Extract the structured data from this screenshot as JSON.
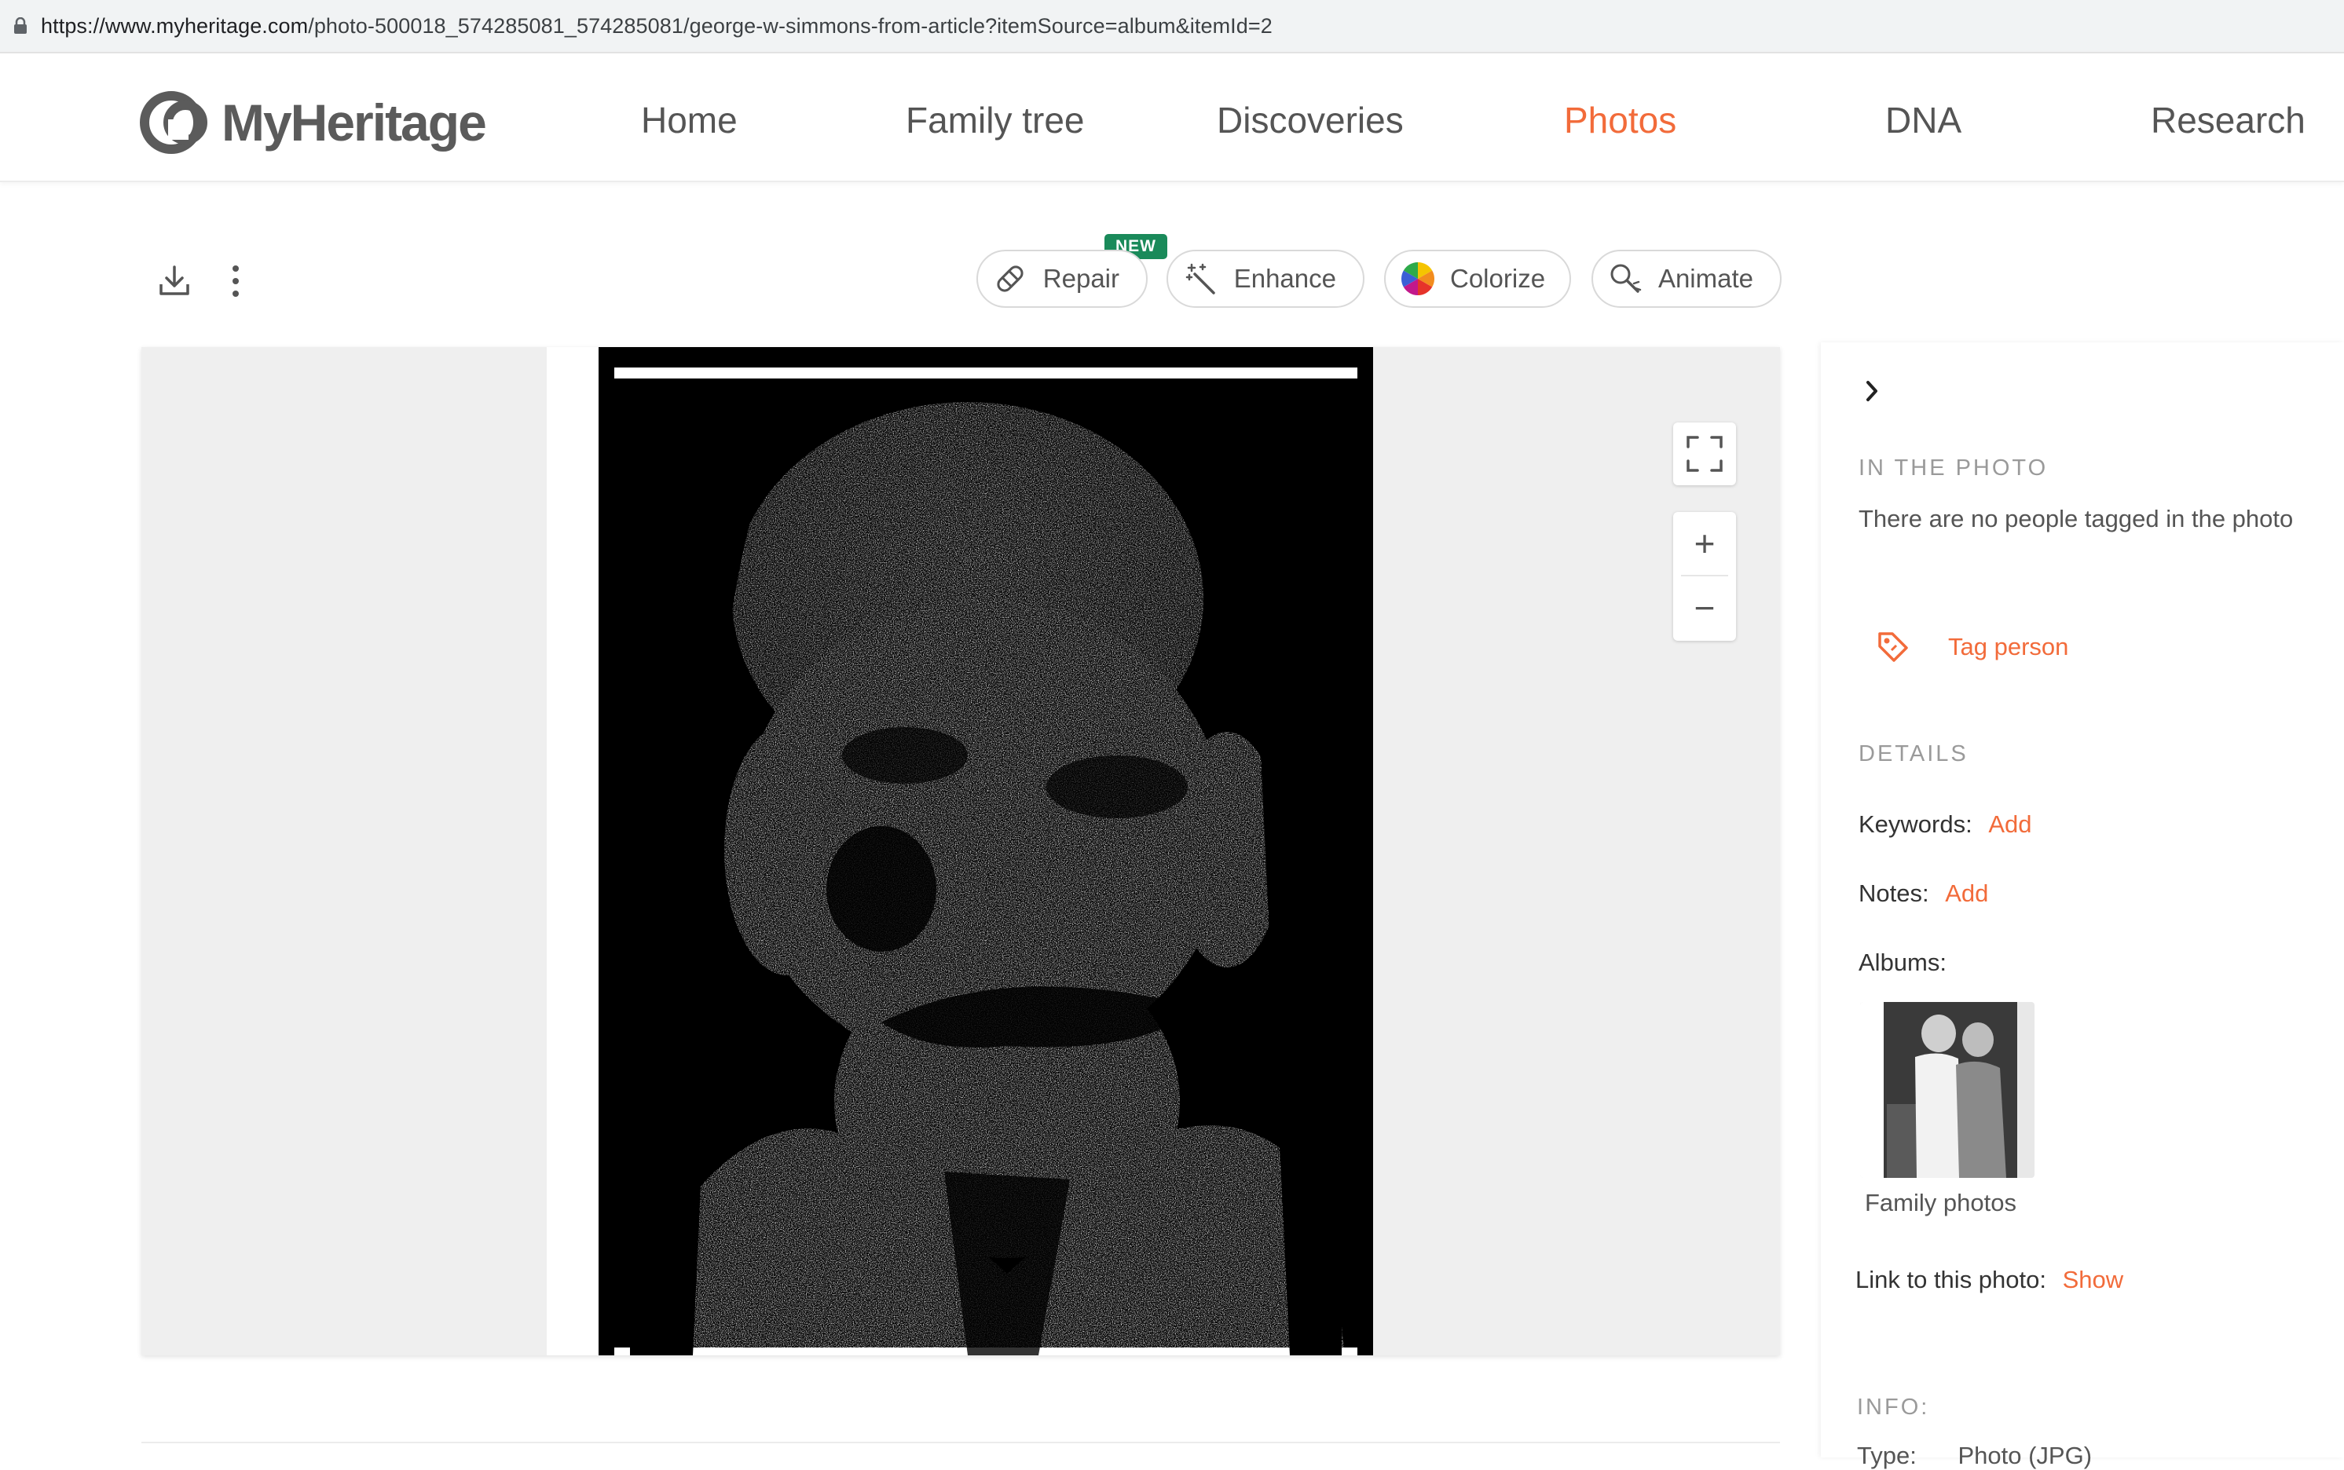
{
  "browser": {
    "url_host": "https://www.myheritage.com",
    "url_path": "/photo-500018_574285081_574285081/george-w-simmons-from-article?itemSource=album&itemId=2"
  },
  "header": {
    "logo_text": "MyHeritage",
    "nav": [
      {
        "label": "Home",
        "active": false
      },
      {
        "label": "Family tree",
        "active": false
      },
      {
        "label": "Discoveries",
        "active": false
      },
      {
        "label": "Photos",
        "active": true
      },
      {
        "label": "DNA",
        "active": false
      },
      {
        "label": "Research",
        "active": false
      }
    ]
  },
  "toolbar": {
    "download_icon": "download-icon",
    "more_icon": "more-vertical-icon",
    "new_badge": "NEW",
    "repair_label": "Repair",
    "enhance_label": "Enhance",
    "colorize_label": "Colorize",
    "animate_label": "Animate"
  },
  "viewer": {
    "zoom_in": "+",
    "zoom_out": "−"
  },
  "side_panel": {
    "in_photo_heading": "IN THE PHOTO",
    "no_people_text": "There are no people tagged in the photo",
    "tag_person_label": "Tag person",
    "details_heading": "DETAILS",
    "keywords_label": "Keywords:",
    "keywords_action": "Add",
    "notes_label": "Notes:",
    "notes_action": "Add",
    "albums_label": "Albums:",
    "album_name": "Family photos",
    "link_label": "Link to this photo:",
    "link_action": "Show",
    "info_heading": "INFO:",
    "type_label": "Type:",
    "type_value": "Photo (JPG)"
  },
  "colors": {
    "accent": "#f26b3a",
    "new_badge": "#1a8a5a",
    "nav_text": "#555555"
  }
}
